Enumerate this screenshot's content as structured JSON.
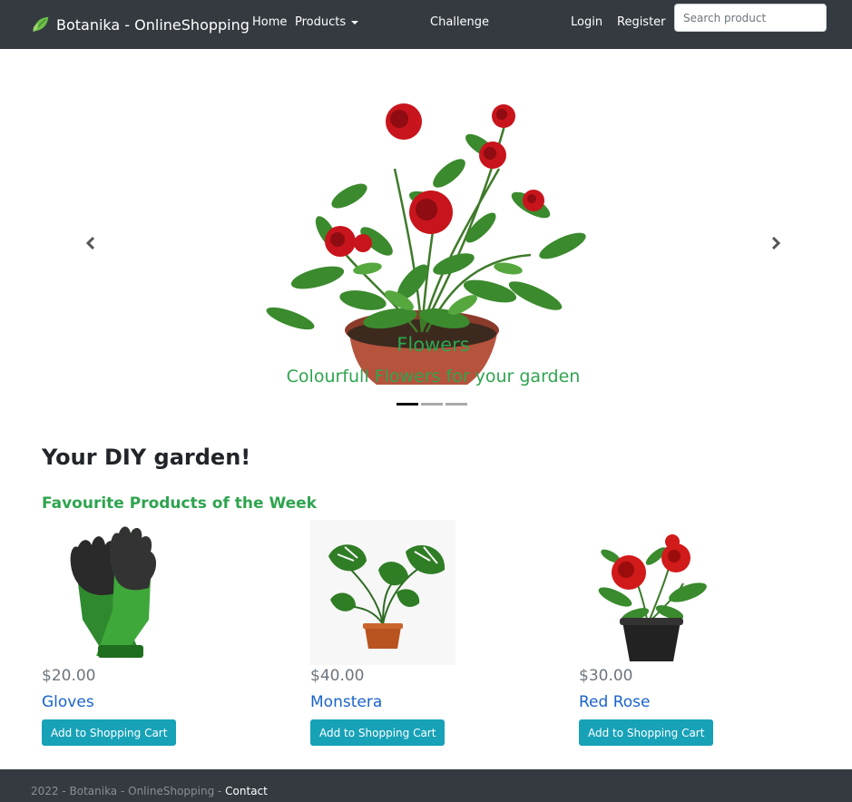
{
  "navbar": {
    "brand": "Botanika - OnlineShopping",
    "links": {
      "home": "Home",
      "products": "Products",
      "challenge": "Challenge",
      "login": "Login",
      "register": "Register"
    },
    "search_placeholder": "Search product"
  },
  "carousel": {
    "title": "Flowers",
    "subtitle": "Colourfull Flowers for your garden",
    "indicator_count": 3,
    "active_index": 0,
    "prev_icon": "chevron-left-icon",
    "next_icon": "chevron-right-icon"
  },
  "main": {
    "title": "Your DIY garden!",
    "subtitle": "Favourite Products of the Week",
    "products": [
      {
        "name": "Gloves",
        "price": "$20.00",
        "button": "Add to Shopping Cart"
      },
      {
        "name": "Monstera",
        "price": "$40.00",
        "button": "Add to Shopping Cart"
      },
      {
        "name": "Red Rose",
        "price": "$30.00",
        "button": "Add to Shopping Cart"
      }
    ]
  },
  "footer": {
    "text": "2022 - Botanika - OnlineShopping - ",
    "link": "Contact"
  },
  "colors": {
    "navbar_bg": "#343a40",
    "accent_green": "#2ea44f",
    "link_blue": "#1a63c9",
    "button_teal": "#17a2b8"
  }
}
